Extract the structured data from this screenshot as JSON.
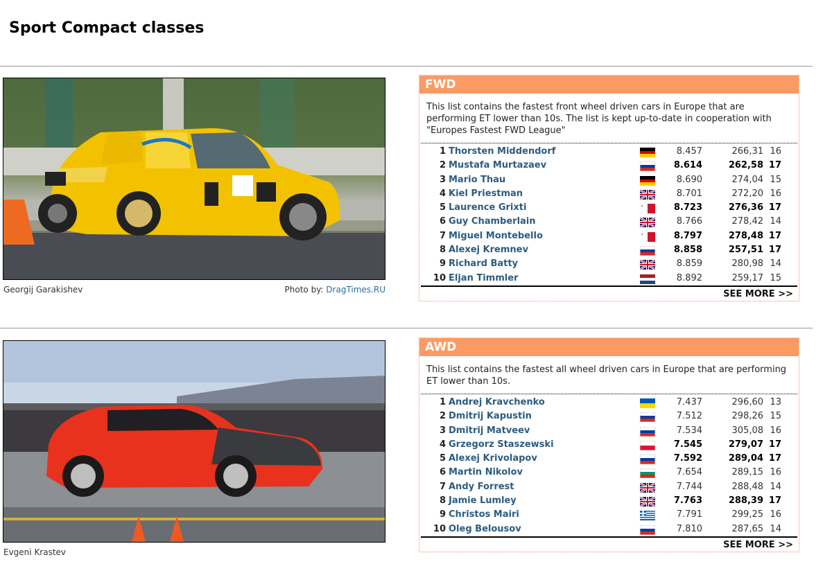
{
  "page": {
    "title": "Sport Compact classes"
  },
  "sections": [
    {
      "caption": "Georgij Garakishev",
      "credit_prefix": "Photo by:",
      "credit_link": "DragTimes.RU",
      "heading": "FWD",
      "description": "This list contains the fastest front wheel driven cars in Europe that are performing ET lower than 10s. The list is kept up-to-date in cooperation with \"Europes Fastest FWD League\"",
      "see_more": "SEE MORE >>",
      "rows": [
        {
          "pos": "1",
          "name": "Thorsten Middendorf",
          "flag": "germany-flag-icon",
          "et": "8.457",
          "speed": "266,31",
          "year": "16",
          "bold": false
        },
        {
          "pos": "2",
          "name": "Mustafa Murtazaev",
          "flag": "russia-flag-icon",
          "et": "8.614",
          "speed": "262,58",
          "year": "17",
          "bold": true
        },
        {
          "pos": "3",
          "name": "Mario Thau",
          "flag": "germany-flag-icon",
          "et": "8.690",
          "speed": "274,04",
          "year": "15",
          "bold": false
        },
        {
          "pos": "4",
          "name": "Kiel Priestman",
          "flag": "uk-flag-icon",
          "et": "8.701",
          "speed": "272,20",
          "year": "16",
          "bold": false
        },
        {
          "pos": "5",
          "name": "Laurence Grixti",
          "flag": "malta-flag-icon",
          "et": "8.723",
          "speed": "276,36",
          "year": "17",
          "bold": true
        },
        {
          "pos": "6",
          "name": "Guy Chamberlain",
          "flag": "uk-flag-icon",
          "et": "8.766",
          "speed": "278,42",
          "year": "14",
          "bold": false
        },
        {
          "pos": "7",
          "name": "Miguel Montebello",
          "flag": "malta-flag-icon",
          "et": "8.797",
          "speed": "278,48",
          "year": "17",
          "bold": true
        },
        {
          "pos": "8",
          "name": "Alexej Kremnev",
          "flag": "russia-flag-icon",
          "et": "8.858",
          "speed": "257,51",
          "year": "17",
          "bold": true
        },
        {
          "pos": "9",
          "name": "Richard Batty",
          "flag": "uk-flag-icon",
          "et": "8.859",
          "speed": "280,98",
          "year": "14",
          "bold": false
        },
        {
          "pos": "10",
          "name": "Eljan Timmler",
          "flag": "netherlands-flag-icon",
          "et": "8.892",
          "speed": "259,17",
          "year": "15",
          "bold": false
        }
      ]
    },
    {
      "caption": "Evgeni Krastev",
      "heading": "AWD",
      "description": "This list contains the fastest all wheel driven cars in Europe that are performing ET lower than 10s.",
      "see_more": "SEE MORE >>",
      "rows": [
        {
          "pos": "1",
          "name": "Andrej Kravchenko",
          "flag": "ukraine-flag-icon",
          "et": "7.437",
          "speed": "296,60",
          "year": "13",
          "bold": false
        },
        {
          "pos": "2",
          "name": "Dmitrij Kapustin",
          "flag": "russia-flag-icon",
          "et": "7.512",
          "speed": "298,26",
          "year": "15",
          "bold": false
        },
        {
          "pos": "3",
          "name": "Dmitrij Matveev",
          "flag": "russia-flag-icon",
          "et": "7.534",
          "speed": "305,08",
          "year": "16",
          "bold": false
        },
        {
          "pos": "4",
          "name": "Grzegorz Staszewski",
          "flag": "poland-flag-icon",
          "et": "7.545",
          "speed": "279,07",
          "year": "17",
          "bold": true
        },
        {
          "pos": "5",
          "name": "Alexej Krivolapov",
          "flag": "russia-flag-icon",
          "et": "7.592",
          "speed": "289,04",
          "year": "17",
          "bold": true
        },
        {
          "pos": "6",
          "name": "Martin Nikolov",
          "flag": "bulgaria-flag-icon",
          "et": "7.654",
          "speed": "289,15",
          "year": "16",
          "bold": false
        },
        {
          "pos": "7",
          "name": "Andy Forrest",
          "flag": "uk-flag-icon",
          "et": "7.744",
          "speed": "288,48",
          "year": "14",
          "bold": false
        },
        {
          "pos": "8",
          "name": "Jamie Lumley",
          "flag": "uk-flag-icon",
          "et": "7.763",
          "speed": "288,39",
          "year": "17",
          "bold": true
        },
        {
          "pos": "9",
          "name": "Christos Mairi",
          "flag": "greece-flag-icon",
          "et": "7.791",
          "speed": "299,25",
          "year": "16",
          "bold": false
        },
        {
          "pos": "10",
          "name": "Oleg Belousov",
          "flag": "russia-flag-icon",
          "et": "7.810",
          "speed": "287,65",
          "year": "14",
          "bold": false
        }
      ]
    }
  ]
}
